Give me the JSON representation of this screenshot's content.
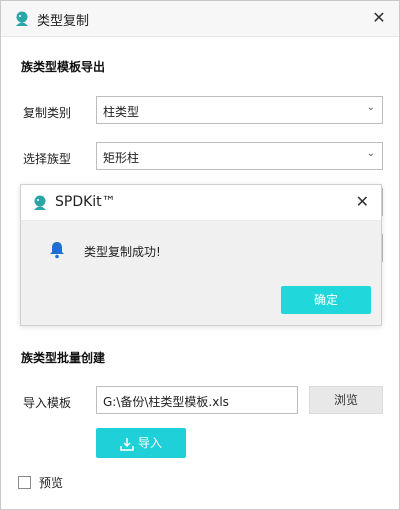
{
  "window": {
    "title": "类型复制",
    "close_glyph": "✕"
  },
  "export_section": {
    "heading": "族类型模板导出",
    "copy_category_label": "复制类别",
    "copy_category_value": "柱类型",
    "family_type_label": "选择族型",
    "family_type_value": "矩形柱"
  },
  "batch_section": {
    "heading": "族类型批量创建",
    "import_template_label": "导入模板",
    "import_template_value": "G:\\备份\\柱类型模板.xls",
    "browse_label": "浏览",
    "import_button_label": "导入"
  },
  "preview": {
    "label": "预览",
    "checked": false
  },
  "dialog": {
    "title": "SPDKit™",
    "message": "类型复制成功!",
    "ok_label": "确定",
    "close_glyph": "✕"
  },
  "colors": {
    "accent": "#20d0d8",
    "app_icon": "#2aa6a6"
  },
  "icons": [
    "app-logo-icon",
    "close-icon",
    "chevron-down-icon",
    "bell-icon",
    "download-icon"
  ]
}
